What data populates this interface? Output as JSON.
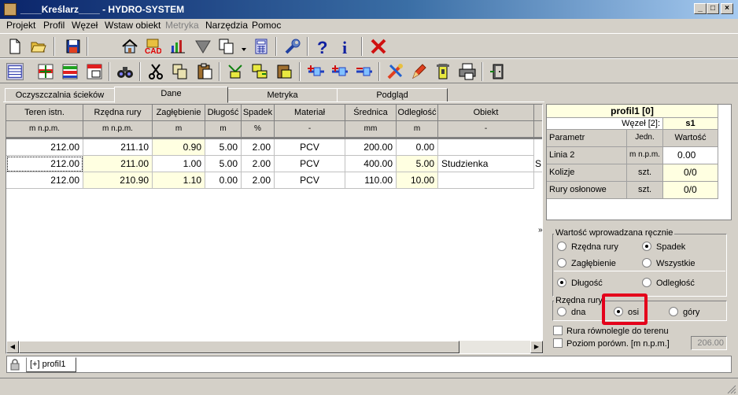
{
  "window": {
    "title": "____Kreślarz____ - HYDRO-SYSTEM",
    "icons": [
      "pencil-app-icon"
    ]
  },
  "menu": [
    {
      "label": "Projekt"
    },
    {
      "label": "Profil"
    },
    {
      "label": "Węzeł"
    },
    {
      "label": "Wstaw obiekt"
    },
    {
      "label": "Metryka",
      "disabled": true
    },
    {
      "label": "Narzędzia"
    },
    {
      "label": "Pomoc"
    }
  ],
  "toolbar1": {
    "icons": [
      "new-file-icon",
      "open-folder-icon",
      "save-icon",
      "home-icon",
      "cad-icon",
      "chart-icon",
      "filter-icon",
      "copy-icon",
      "calculator-icon",
      "wrench-icon",
      "help-icon",
      "info-icon",
      "close-icon"
    ],
    "cad_label": "CAD",
    "help_label": "?",
    "info_label": "i"
  },
  "toolbar2": {
    "icons": [
      "table-view-icon",
      "insert-row-icon",
      "delete-row-icon",
      "table-ab-icon",
      "binoculars-icon",
      "scissors-icon",
      "copy-icon",
      "paste-icon",
      "node-icon",
      "node-copy-icon",
      "node-paste-icon",
      "add-node-icon",
      "add-node-right-icon",
      "remove-node-icon",
      "tools-icon",
      "pen-icon",
      "manhole-icon",
      "print-icon",
      "exit-icon"
    ]
  },
  "tabs": [
    {
      "label": "Oczyszczalnia ścieków",
      "active": false
    },
    {
      "label": "Dane",
      "active": true
    },
    {
      "label": "Metryka",
      "active": false
    },
    {
      "label": "Podgląd",
      "active": false
    }
  ],
  "table": {
    "columns": [
      {
        "header": "Teren istn.",
        "unit": "m n.p.m."
      },
      {
        "header": "Rzędna rury",
        "unit": "m n.p.m."
      },
      {
        "header": "Zagłębienie",
        "unit": "m"
      },
      {
        "header": "Długość",
        "unit": "m"
      },
      {
        "header": "Spadek",
        "unit": "%"
      },
      {
        "header": "Materiał",
        "unit": "-"
      },
      {
        "header": "Średnica",
        "unit": "mm"
      },
      {
        "header": "Odległość",
        "unit": "m"
      },
      {
        "header": "Obiekt",
        "unit": "-"
      }
    ],
    "rows": [
      [
        "212.00",
        "211.10",
        "0.90",
        "5.00",
        "2.00",
        "PCV",
        "200.00",
        "0.00",
        ""
      ],
      [
        "212.00",
        "211.00",
        "1.00",
        "5.00",
        "2.00",
        "PCV",
        "400.00",
        "5.00",
        "Studzienka"
      ],
      [
        "212.00",
        "210.90",
        "1.10",
        "0.00",
        "2.00",
        "PCV",
        "110.00",
        "10.00",
        ""
      ]
    ],
    "overflow_char": "S"
  },
  "profile_panel": {
    "title": "profil1 [0]",
    "node_label": "Węzeł [2]:",
    "node_value": "s1",
    "headers": [
      "Parametr",
      "Jedn.",
      "Wartość"
    ],
    "rows": [
      [
        "Linia 2",
        "m n.p.m.",
        "0.00"
      ],
      [
        "Kolizje",
        "szt.",
        "0/0"
      ],
      [
        "Rury osłonowe",
        "szt.",
        "0/0"
      ]
    ]
  },
  "expand_marker": "»",
  "manual_value": {
    "legend": "Wartość wprowadzana ręcznie",
    "options": [
      {
        "label": "Rzędna rury",
        "checked": false
      },
      {
        "label": "Spadek",
        "checked": true
      },
      {
        "label": "Zagłębienie",
        "checked": false
      },
      {
        "label": "Wszystkie",
        "checked": false
      }
    ],
    "options2": [
      {
        "label": "Długość",
        "checked": true
      },
      {
        "label": "Odległość",
        "checked": false
      }
    ]
  },
  "pipe_elevation": {
    "legend": "Rzędna rury",
    "options": [
      {
        "label": "dna",
        "checked": false
      },
      {
        "label": "osi",
        "checked": true
      },
      {
        "label": "góry",
        "checked": false
      }
    ]
  },
  "checkboxes": [
    {
      "label": "Rura równolegle do terenu",
      "checked": false
    },
    {
      "label": "Poziom porówn. [m n.p.m.]",
      "checked": false
    }
  ],
  "ref_level_value": "206.00",
  "bottom_tab": {
    "label": "[+] profil1"
  },
  "bottom_icons": [
    "lock-icon"
  ],
  "window_buttons": {
    "minimize": "_",
    "maximize": "□",
    "close": "×"
  }
}
